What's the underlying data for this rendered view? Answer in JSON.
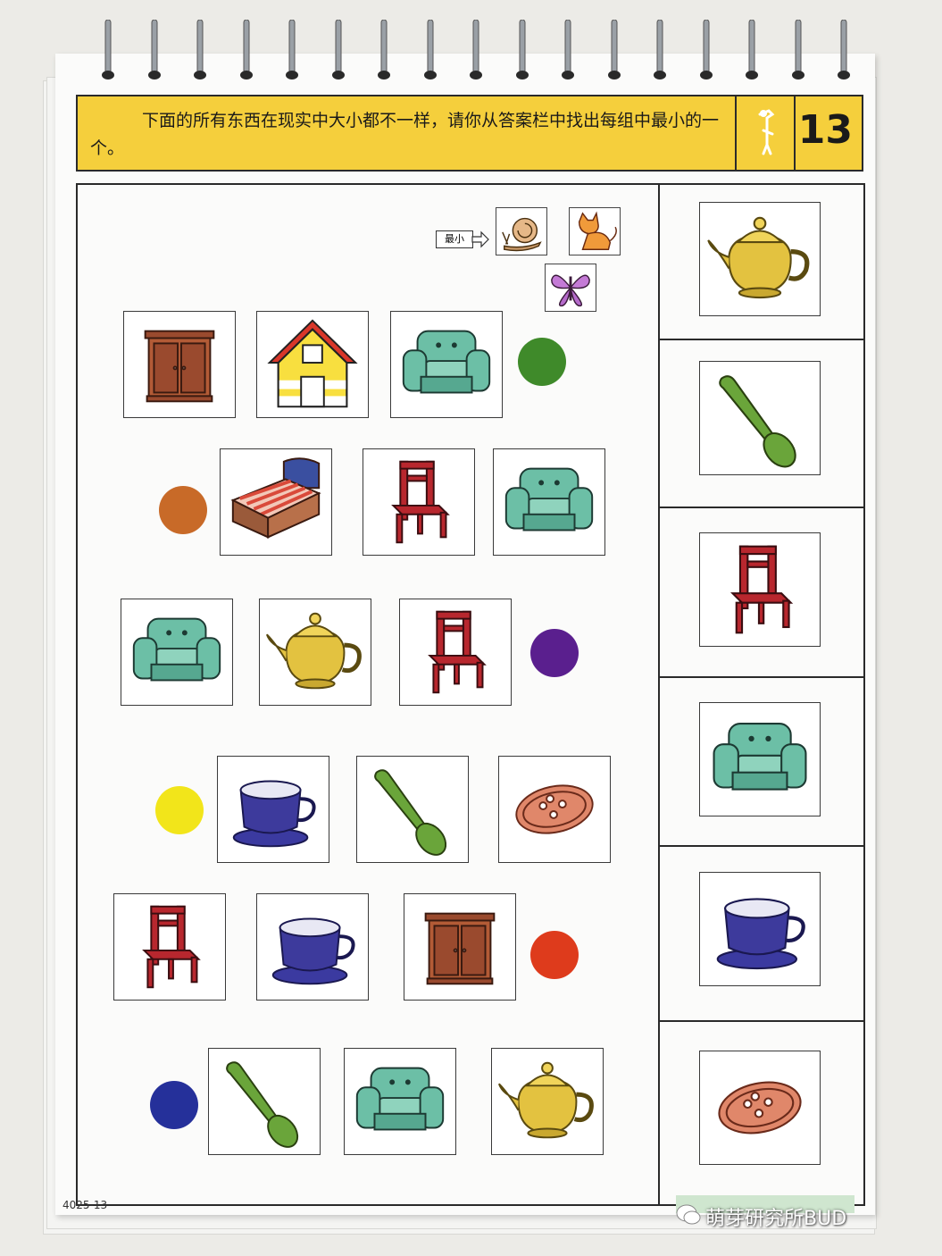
{
  "instruction": "下面的所有东西在现实中大小都不一样，请你从答案栏中找出每组中最小的一个。",
  "page_number": "13",
  "legend_label": "最小",
  "legend_icons": [
    "snail-icon",
    "cat-icon",
    "butterfly-icon"
  ],
  "rows": [
    {
      "items": [
        "wardrobe-icon",
        "house-icon",
        "armchair-icon"
      ],
      "dot_color": "#3f8a2a"
    },
    {
      "items": [
        "bed-icon",
        "chair-icon",
        "armchair-icon"
      ],
      "dot_color": "#c86a28"
    },
    {
      "items": [
        "armchair-icon",
        "teapot-icon",
        "chair-icon"
      ],
      "dot_color": "#5a1f8e"
    },
    {
      "items": [
        "cup-icon",
        "spoon-icon",
        "button-icon"
      ],
      "dot_color": "#f2e51a"
    },
    {
      "items": [
        "chair-icon",
        "cup-icon",
        "wardrobe-icon"
      ],
      "dot_color": "#de3b1c"
    },
    {
      "items": [
        "spoon-icon",
        "armchair-icon",
        "teapot-icon"
      ],
      "dot_color": "#25309a"
    }
  ],
  "answers": [
    "teapot-icon",
    "spoon-icon",
    "chair-icon",
    "armchair-icon",
    "cup-icon",
    "button-icon"
  ],
  "colors": {
    "banner": "#f5cf3c",
    "armchair": "#6cbfa6",
    "chair": "#b8272e",
    "wardrobe": "#9a4a2e",
    "teapot": "#e3c240",
    "cup": "#3d3a9c",
    "spoon": "#6aa53a",
    "button": "#e0876a"
  },
  "footer_code": "4025-13",
  "watermark": "萌芽研究所BUD"
}
